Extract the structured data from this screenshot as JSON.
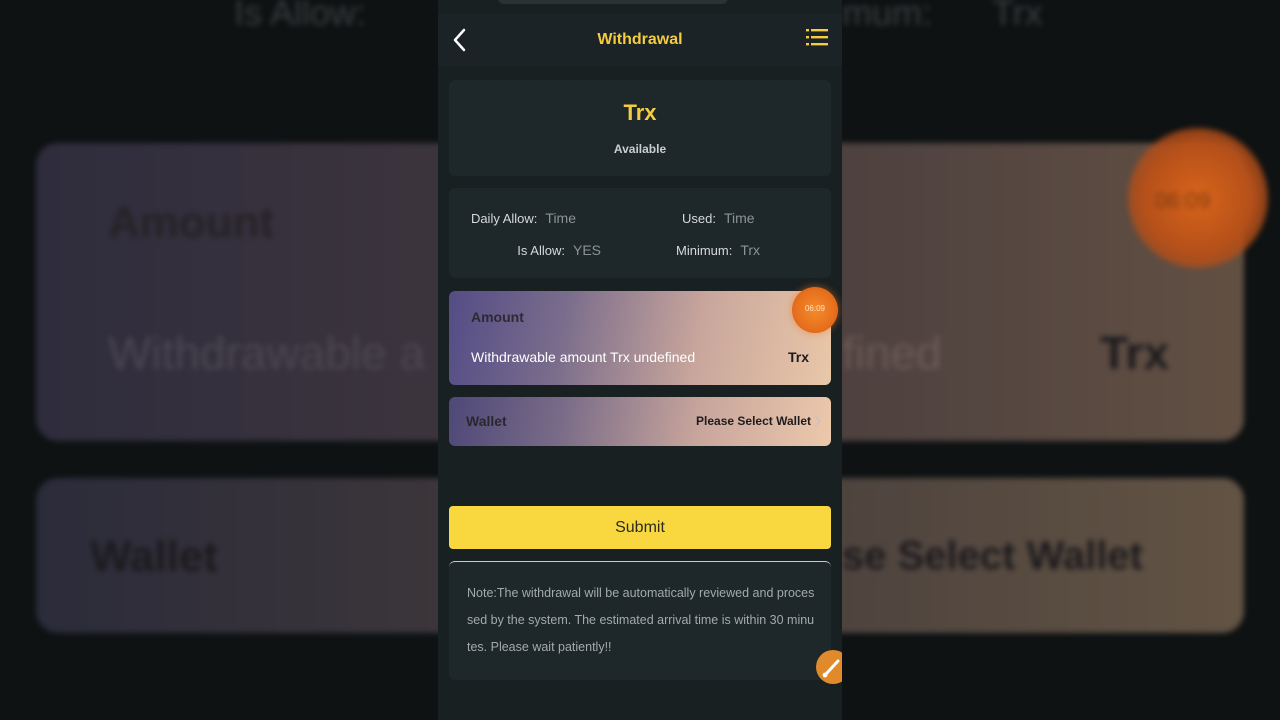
{
  "header": {
    "title": "Withdrawal"
  },
  "balance": {
    "coin": "Trx",
    "label": "Available"
  },
  "limits": {
    "daily_allow_label": "Daily Allow:",
    "daily_allow_value": "Time",
    "used_label": "Used:",
    "used_value": "Time",
    "is_allow_label": "Is Allow:",
    "is_allow_value": "YES",
    "minimum_label": "Minimum:",
    "minimum_value": "Trx"
  },
  "amount": {
    "label": "Amount",
    "placeholder": "Withdrawable amount Trx undefined",
    "unit": "Trx"
  },
  "wallet": {
    "label": "Wallet",
    "select_text": "Please Select Wallet"
  },
  "submit_label": "Submit",
  "note": "Note:The withdrawal will be automatically reviewed and processed by the system. The estimated arrival time is within 30 minutes. Please wait patiently!!",
  "timer_badge": "06:09",
  "background_echo": {
    "is_allow": "Is Allow:",
    "minimum": "mum:",
    "trx": "Trx",
    "amount": "Amount",
    "withdrawable": "Withdrawable a",
    "fined": "fined",
    "trx_unit": "Trx",
    "wallet": "Wallet",
    "select": "se Select Wallet",
    "timer": "06:09"
  },
  "colors": {
    "accent": "#f5cb3f",
    "submit_bg": "#f9d83f",
    "screen_bg": "#182022",
    "card_bg": "#1e2729"
  }
}
